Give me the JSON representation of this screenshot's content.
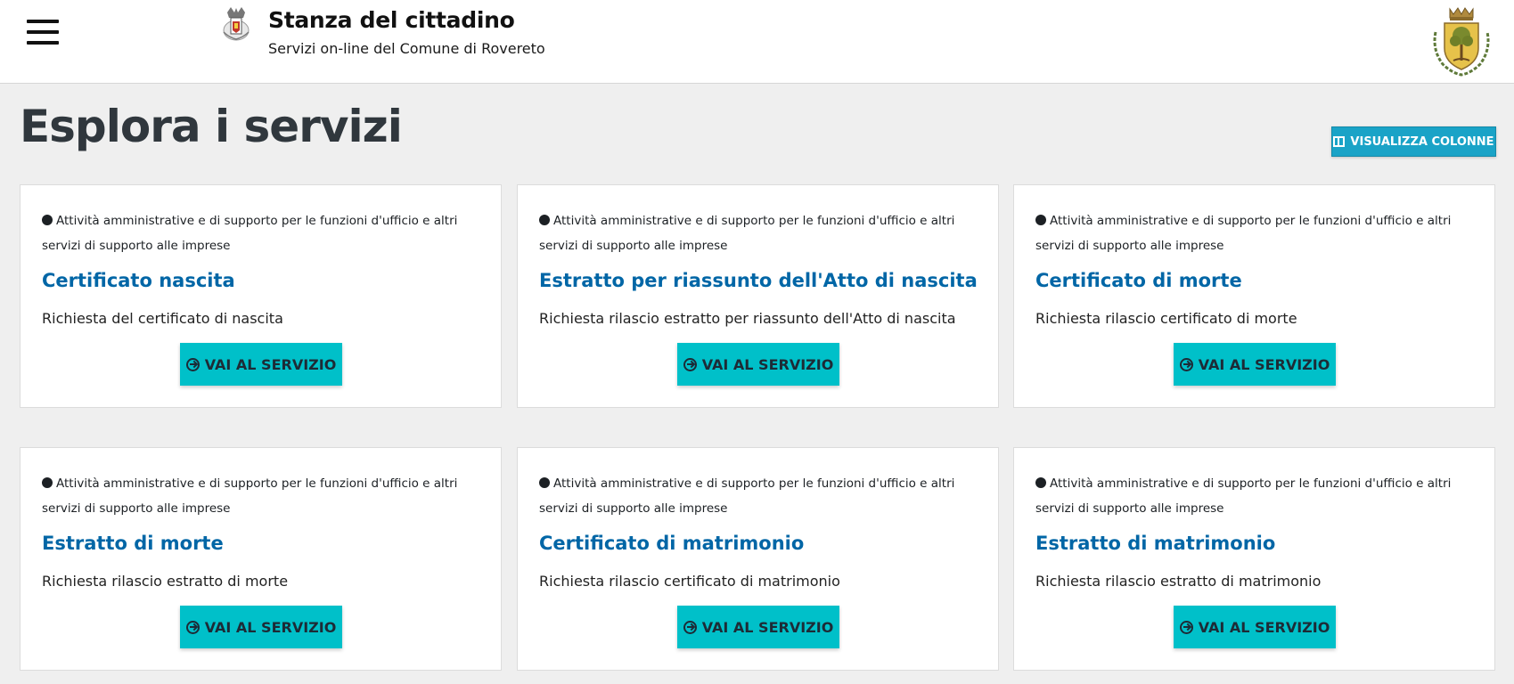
{
  "header": {
    "brand_title": "Stanza del cittadino",
    "brand_subtitle": "Servizi on-line del Comune di Rovereto"
  },
  "page": {
    "title": "Esplora i servizi",
    "columns_button": "VISUALIZZA COLONNE"
  },
  "cards": [
    {
      "category": "Attività amministrative e di supporto per le funzioni d'ufficio e altri servizi di supporto alle imprese",
      "title": "Certificato nascita",
      "description": "Richiesta del certificato di nascita",
      "button": "VAI AL SERVIZIO"
    },
    {
      "category": "Attività amministrative e di supporto per le funzioni d'ufficio e altri servizi di supporto alle imprese",
      "title": "Estratto per riassunto dell'Atto di nascita",
      "description": "Richiesta rilascio estratto per riassunto dell'Atto di nascita",
      "button": "VAI AL SERVIZIO"
    },
    {
      "category": "Attività amministrative e di supporto per le funzioni d'ufficio e altri servizi di supporto alle imprese",
      "title": "Certificato di morte",
      "description": "Richiesta rilascio certificato di morte",
      "button": "VAI AL SERVIZIO"
    },
    {
      "category": "Attività amministrative e di supporto per le funzioni d'ufficio e altri servizi di supporto alle imprese",
      "title": "Estratto di morte",
      "description": "Richiesta rilascio estratto di morte",
      "button": "VAI AL SERVIZIO"
    },
    {
      "category": "Attività amministrative e di supporto per le funzioni d'ufficio e altri servizi di supporto alle imprese",
      "title": "Certificato di matrimonio",
      "description": "Richiesta rilascio certificato di matrimonio",
      "button": "VAI AL SERVIZIO"
    },
    {
      "category": "Attività amministrative e di supporto per le funzioni d'ufficio e altri servizi di supporto alle imprese",
      "title": "Estratto di matrimonio",
      "description": "Richiesta rilascio estratto di matrimonio",
      "button": "VAI AL SERVIZIO"
    }
  ],
  "icons": {
    "menu": "hamburger-menu-icon",
    "brand": "comune-logo-icon",
    "coat_of_arms": "coat-of-arms-icon",
    "columns": "columns-icon",
    "go": "arrow-circle-right-icon"
  },
  "colors": {
    "accent": "#00c0c9",
    "title_link": "#0066a6",
    "columns_button": "#1aa3c7",
    "background": "#efefef"
  }
}
